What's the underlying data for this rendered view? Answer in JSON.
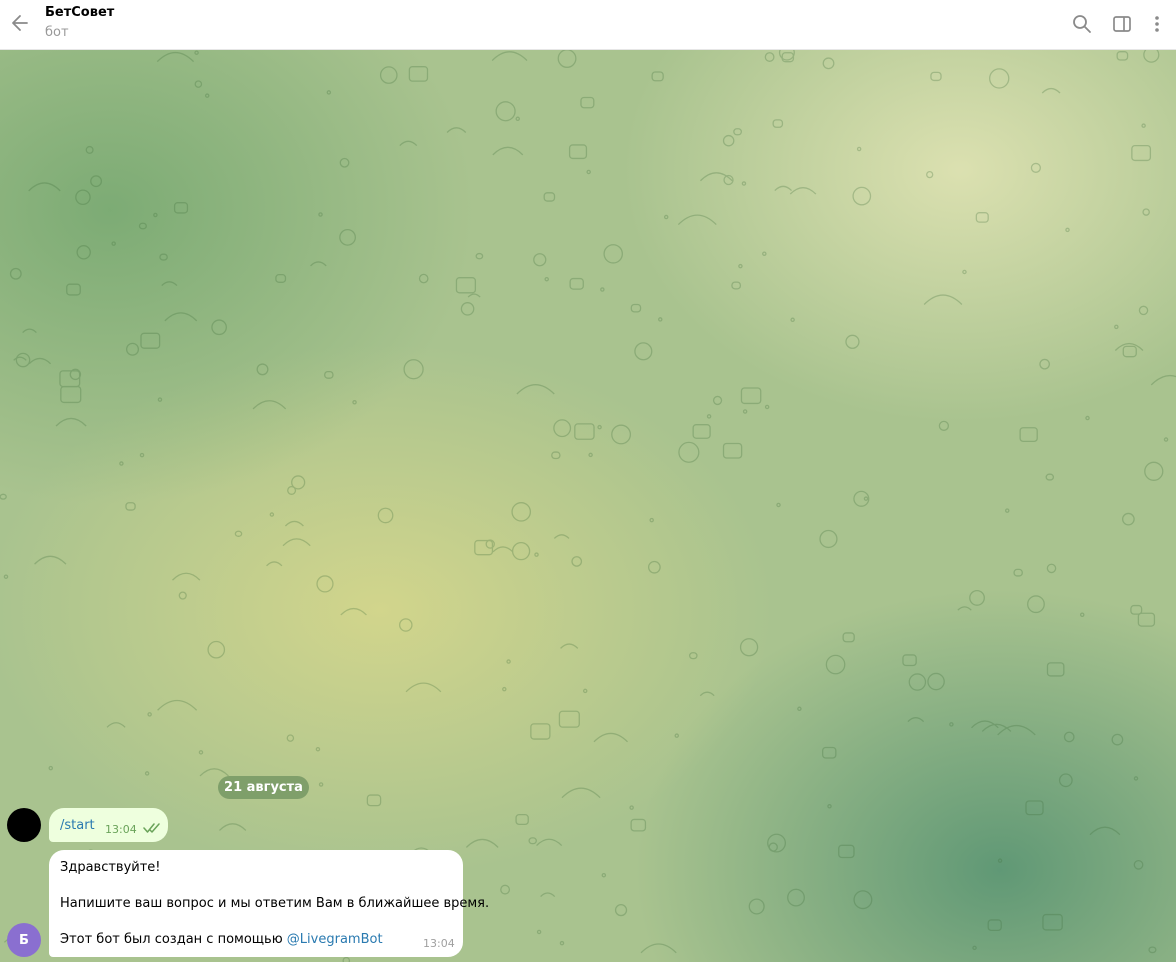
{
  "header": {
    "title": "БетСовет",
    "subtitle": "бот"
  },
  "chat": {
    "date_label": "21 августа",
    "outgoing": {
      "text": "/start",
      "time": "13:04"
    },
    "incoming": {
      "sender_initial": "Б",
      "line1": "Здравствуйте!",
      "line2": "Напишите ваш вопрос и мы ответим Вам в ближайшее время.",
      "line3_prefix": "Этот бот был создан с помощью ",
      "line3_link": "@LivegramBot",
      "time": "13:04"
    }
  },
  "colors": {
    "header_bg": "#ffffff",
    "outgoing_bubble": "#eeffde",
    "incoming_bubble": "#ffffff",
    "link": "#2a7ab0",
    "read_check": "#6aa35a",
    "bot_avatar": "#8a6fd0"
  },
  "icons": [
    "back-arrow-icon",
    "search-icon",
    "sidebar-toggle-icon",
    "more-vertical-icon",
    "double-check-icon"
  ]
}
